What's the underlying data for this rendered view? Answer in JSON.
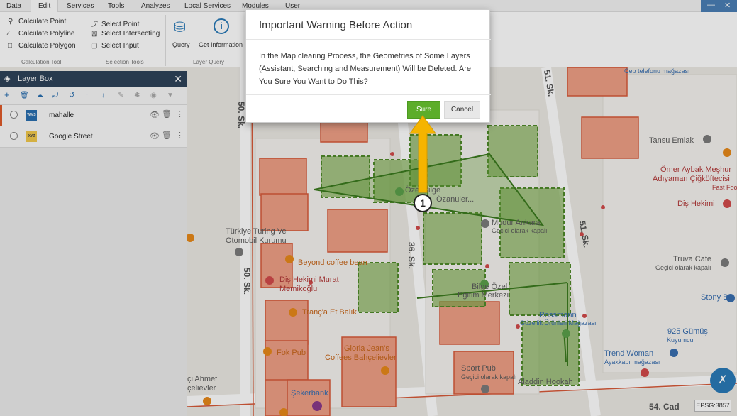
{
  "menu": {
    "items": [
      "Data",
      "Edit",
      "Services",
      "Tools",
      "Analyzes",
      "Local Services",
      "Modules",
      "User"
    ],
    "active": "Edit"
  },
  "ribbon": {
    "calc_tools": [
      "Calculate Point",
      "Calculate Polyline",
      "Calculate Polygon"
    ],
    "calc_group_label": "Calculation Tool",
    "select_tools": [
      "Select Point",
      "Select Intersecting",
      "Select Input"
    ],
    "select_group_label": "Selection Tools",
    "query_label": "Query",
    "get_info_label": "Get Information",
    "query_group_label": "Layer Query"
  },
  "layer_box": {
    "title": "Layer Box",
    "layers": [
      {
        "name": "mahalle",
        "thumb": "WMS"
      },
      {
        "name": "Google Street",
        "thumb": "XYZ"
      }
    ]
  },
  "map": {
    "streets": [
      "50. Sk.",
      "50. Sk.",
      "36. Sk.",
      "51. Sk.",
      "51. Sk.",
      "54. Cad"
    ],
    "pois": [
      {
        "name": "Türkiye Turing Ve",
        "sub": ""
      },
      {
        "name": "Otomobil Kurumu",
        "sub": ""
      },
      {
        "name": "Beyond coffee bean",
        "sub": ""
      },
      {
        "name": "Diş Hekimi Murat",
        "sub": ""
      },
      {
        "name": "Memikoğlu",
        "sub": ""
      },
      {
        "name": "Tranç'a Et Balık",
        "sub": ""
      },
      {
        "name": "Fok Pub",
        "sub": ""
      },
      {
        "name": "Gloria Jean's",
        "sub": ""
      },
      {
        "name": "Coffees Bahçelievler",
        "sub": ""
      },
      {
        "name": "Şekerbank",
        "sub": ""
      },
      {
        "name": "Sport Pub",
        "sub": "Geçici olarak kapalı"
      },
      {
        "name": "Aladdin Hookah",
        "sub": ""
      },
      {
        "name": "Bilge Özel",
        "sub": ""
      },
      {
        "name": "Eğitim Merkezi",
        "sub": ""
      },
      {
        "name": "Rossmann",
        "sub": "Güzellik Ürünleri Mağazası"
      },
      {
        "name": "Mudur Ankara",
        "sub": "Geçici olarak kapalı"
      },
      {
        "name": "Tansu Emlak",
        "sub": ""
      },
      {
        "name": "Ömer Aybak Meşhur",
        "sub": ""
      },
      {
        "name": "Adıyaman Çiğköftecisi",
        "sub": "Fast Food"
      },
      {
        "name": "Diş Hekimi",
        "sub": ""
      },
      {
        "name": "Truva Cafe",
        "sub": "Geçici olarak kapalı"
      },
      {
        "name": "Stony Bo",
        "sub": ""
      },
      {
        "name": "925 Gümüş",
        "sub": "Kuyumcu"
      },
      {
        "name": "Trend Woman",
        "sub": "Ayakkabı mağazası"
      },
      {
        "name": "Cep telefonu mağazası",
        "sub": ""
      },
      {
        "name": "çi Ahmet",
        "sub": ""
      },
      {
        "name": "çelievler",
        "sub": ""
      },
      {
        "name": "Özel Bilge",
        "sub": ""
      },
      {
        "name": "Özanuler...",
        "sub": ""
      }
    ],
    "epsg": "EPSG:3857"
  },
  "dialog": {
    "title": "Important Warning Before Action",
    "message": "In the Map clearing Process, the Geometries of Some Layers (Assistant, Searching and Measurement) Will be Deleted. Are You Sure You Want to Do This?",
    "sure_label": "Sure",
    "cancel_label": "Cancel"
  },
  "annotation": {
    "step_number": "1",
    "arrow_color": "#f5b400"
  },
  "colors": {
    "layer_header": "#2e4259",
    "building_fill": "#f0a086",
    "building_stroke": "#d85a3a",
    "selection_fill": "#7aab4a",
    "sure_button": "#5cad2a",
    "accent_blue": "#2a7ab8"
  },
  "icons": {
    "layers": "layers-icon",
    "close": "close-icon",
    "eye": "eye-icon",
    "trash": "trash-icon",
    "more": "more-vertical-icon",
    "database": "database-icon",
    "info": "info-icon",
    "fab": "tools-icon"
  }
}
